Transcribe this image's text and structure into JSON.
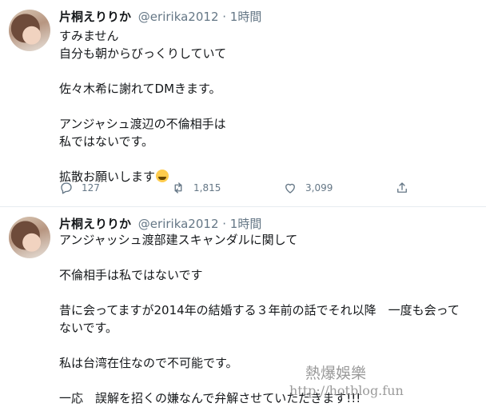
{
  "tweets": [
    {
      "name": "片桐えりりか",
      "handle": "@eririka2012 · 1時間",
      "lines": [
        "すみません",
        "自分も朝からびっくりしていて",
        "",
        "佐々木希に謝れてDMきます。",
        "",
        "アンジャシュ渡辺の不倫相手は",
        "私ではないです。",
        "",
        "拡散お願いします"
      ],
      "emoji": "weary-face-emoji",
      "reply_count": "127",
      "retweet_count": "1,815",
      "like_count": "3,099"
    },
    {
      "name": "片桐えりりか",
      "handle": "@eririka2012 · 1時間",
      "lines": [
        "アンジャッシュ渡部建スキャンダルに関して",
        "",
        "不倫相手は私ではないです",
        "",
        "昔に会ってますが2014年の結婚する３年前の話でそれ以降　一度も会って",
        "ないです。",
        "",
        "私は台湾在住なので不可能です。",
        "",
        "一応　誤解を招くの嫌なんで弁解させていただきます!!!"
      ]
    }
  ],
  "watermark": {
    "site_name": "熱爆娛樂",
    "url": "http://hotblog.fun"
  },
  "colors": {
    "text": "#14171a",
    "secondary": "#657786",
    "divider": "#e6ecf0"
  },
  "icons": [
    "reply-icon",
    "retweet-icon",
    "like-icon",
    "share-icon"
  ]
}
